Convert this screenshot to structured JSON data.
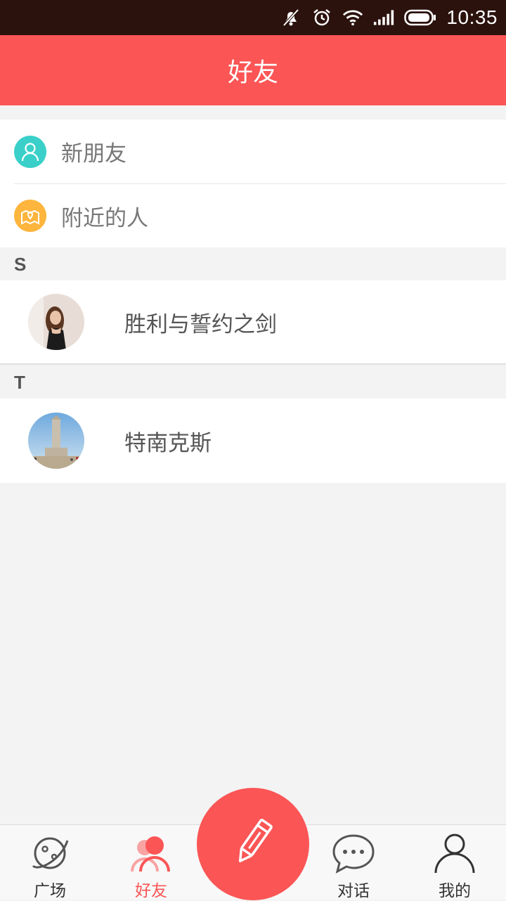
{
  "status_bar": {
    "time": "10:35"
  },
  "header": {
    "title": "好友"
  },
  "menu": {
    "items": [
      {
        "label": "新朋友",
        "icon": "person-icon",
        "color": "#3ad0c9"
      },
      {
        "label": "附近的人",
        "icon": "map-pin-icon",
        "color": "#fdb53d"
      }
    ]
  },
  "sections": [
    {
      "letter": "S",
      "contacts": [
        {
          "name": "胜利与誓约之剑"
        }
      ]
    },
    {
      "letter": "T",
      "contacts": [
        {
          "name": "特南克斯"
        }
      ]
    }
  ],
  "tabbar": {
    "tabs": [
      {
        "label": "广场",
        "icon": "planet-icon"
      },
      {
        "label": "好友",
        "icon": "friends-icon",
        "active": true
      },
      {
        "label": "对话",
        "icon": "chat-bubble-icon"
      },
      {
        "label": "我的",
        "icon": "profile-icon"
      }
    ],
    "compose_icon": "pencil-icon"
  },
  "colors": {
    "accent": "#fb5555",
    "status_bar": "#2b120d",
    "background": "#f3f3f3"
  }
}
